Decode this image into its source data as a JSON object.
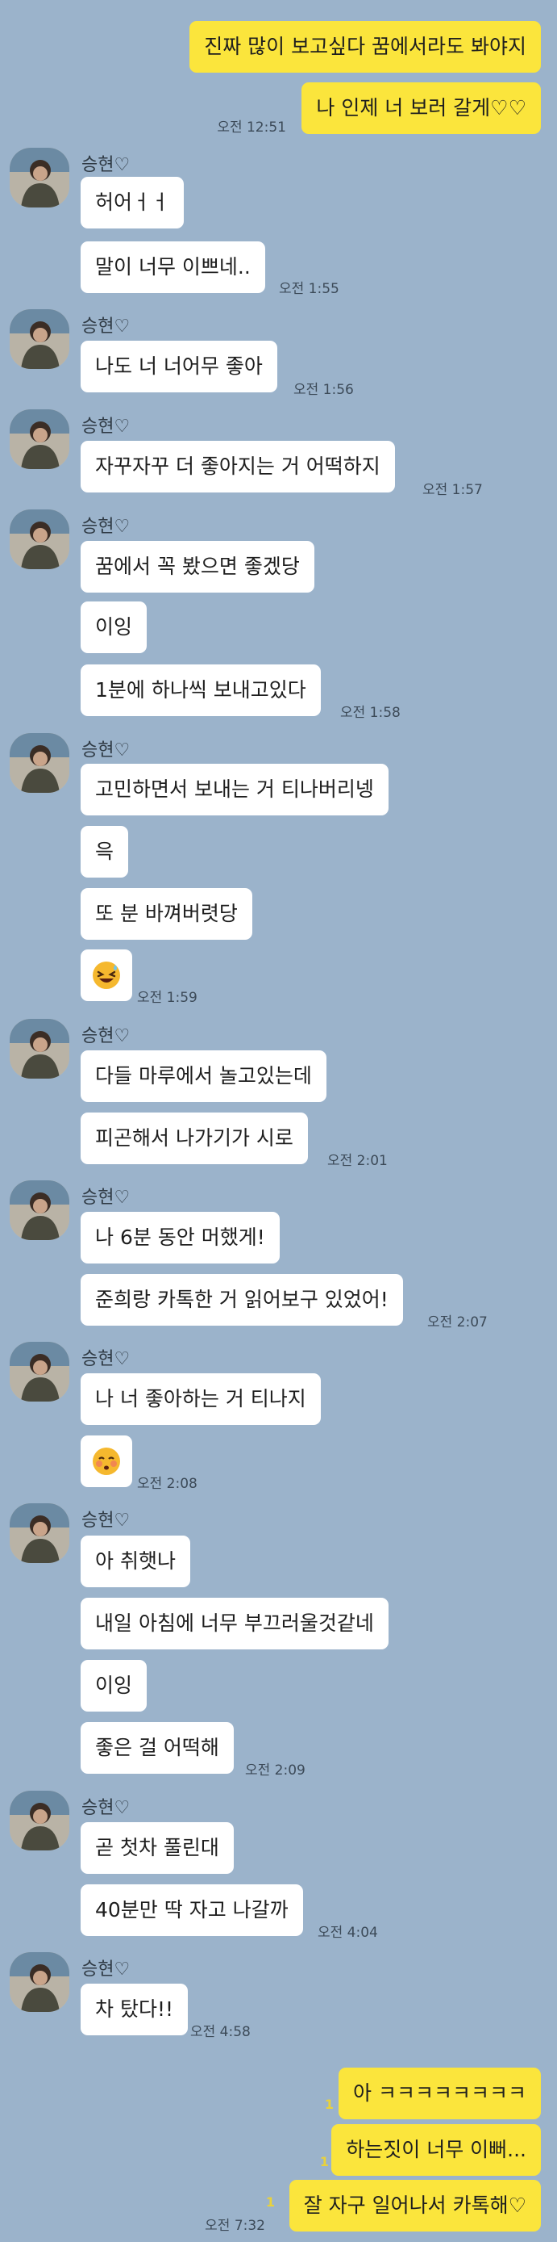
{
  "colors": {
    "background": "#9bb3cb",
    "outgoing_bubble": "#fbe53c",
    "incoming_bubble": "#ffffff"
  },
  "sender_name": "승현♡",
  "outgoing_top": [
    {
      "text": "진짜 많이 보고싶다 꿈에서라도 봐야지"
    },
    {
      "text": "나 인제 너 보러 갈게♡♡",
      "time": "오전 12:51"
    }
  ],
  "groups": [
    {
      "messages": [
        {
          "text": "허어ㅓㅓ"
        },
        {
          "text": "말이 너무 이쁘네..",
          "time": "오전 1:55"
        }
      ]
    },
    {
      "messages": [
        {
          "text": "나도 너 너어무 좋아",
          "time": "오전 1:56"
        }
      ]
    },
    {
      "messages": [
        {
          "text": "자꾸자꾸 더 좋아지는 거 어떡하지",
          "time": "오전 1:57"
        }
      ]
    },
    {
      "messages": [
        {
          "text": "꿈에서 꼭 봤으면 좋겠당"
        },
        {
          "text": "이잉"
        },
        {
          "text": "1분에 하나씩 보내고있다",
          "time": "오전 1:58"
        }
      ]
    },
    {
      "messages": [
        {
          "text": "고민하면서 보내는 거 티나버리넹"
        },
        {
          "text": "윽"
        },
        {
          "text": "또 분 바껴버렷당"
        },
        {
          "emoji": "laughing-sweat-emoji",
          "time": "오전 1:59"
        }
      ]
    },
    {
      "messages": [
        {
          "text": "다들 마루에서 놀고있는데"
        },
        {
          "text": "피곤해서 나가기가 시로",
          "time": "오전 2:01"
        }
      ]
    },
    {
      "messages": [
        {
          "text": "나 6분 동안 머했게!"
        },
        {
          "text": "준희랑 카톡한 거 읽어보구 있었어!",
          "time": "오전 2:07"
        }
      ]
    },
    {
      "messages": [
        {
          "text": "나 너 좋아하는 거 티나지"
        },
        {
          "emoji": "flustered-emoji",
          "time": "오전 2:08"
        }
      ]
    },
    {
      "messages": [
        {
          "text": "아 취햇나"
        },
        {
          "text": "내일 아침에 너무 부끄러울것같네"
        },
        {
          "text": "이잉"
        },
        {
          "text": "좋은 걸 어떡해",
          "time": "오전 2:09"
        }
      ]
    },
    {
      "messages": [
        {
          "text": "곧 첫차 풀린대"
        },
        {
          "text": "40분만 딱 자고 나갈까",
          "time": "오전 4:04"
        }
      ]
    },
    {
      "messages": [
        {
          "text": "차 탔다!!",
          "time": "오전 4:58"
        }
      ]
    }
  ],
  "outgoing_bottom": [
    {
      "text": "아 ㅋㅋㅋㅋㅋㅋㅋㅋ",
      "unread": "1"
    },
    {
      "text": "하는짓이 너무 이뻐...",
      "unread": "1"
    },
    {
      "text": "잘 자구 일어나서 카톡해♡",
      "unread": "1",
      "time": "오전 7:32"
    }
  ]
}
